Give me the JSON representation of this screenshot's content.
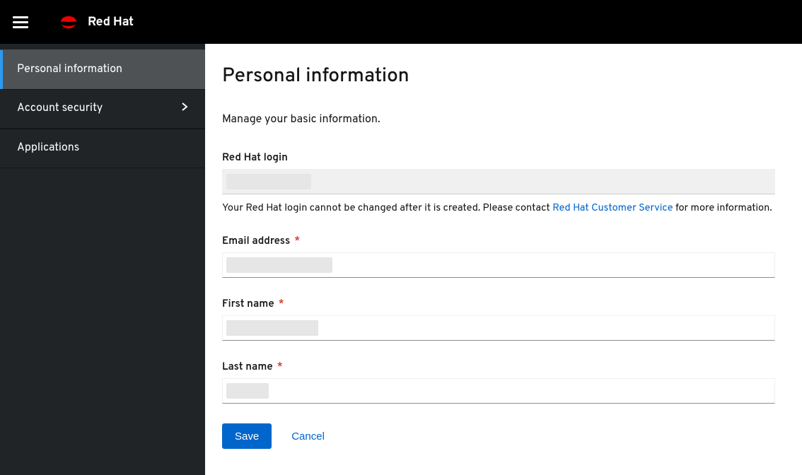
{
  "brand": {
    "name": "Red Hat"
  },
  "sidebar": {
    "items": [
      {
        "label": "Personal information",
        "active": true,
        "chevron": false
      },
      {
        "label": "Account security",
        "active": false,
        "chevron": true
      },
      {
        "label": "Applications",
        "active": false,
        "chevron": false
      }
    ]
  },
  "page": {
    "title": "Personal information",
    "subtitle": "Manage your basic information."
  },
  "fields": {
    "login": {
      "label": "Red Hat login",
      "value": "",
      "hint_pre": "Your Red Hat login cannot be changed after it is created. Please contact ",
      "hint_link": "Red Hat Customer Service",
      "hint_post": " for more information."
    },
    "email": {
      "label": "Email address",
      "value": ""
    },
    "first_name": {
      "label": "First name",
      "value": ""
    },
    "last_name": {
      "label": "Last name",
      "value": ""
    }
  },
  "actions": {
    "save": "Save",
    "cancel": "Cancel"
  }
}
